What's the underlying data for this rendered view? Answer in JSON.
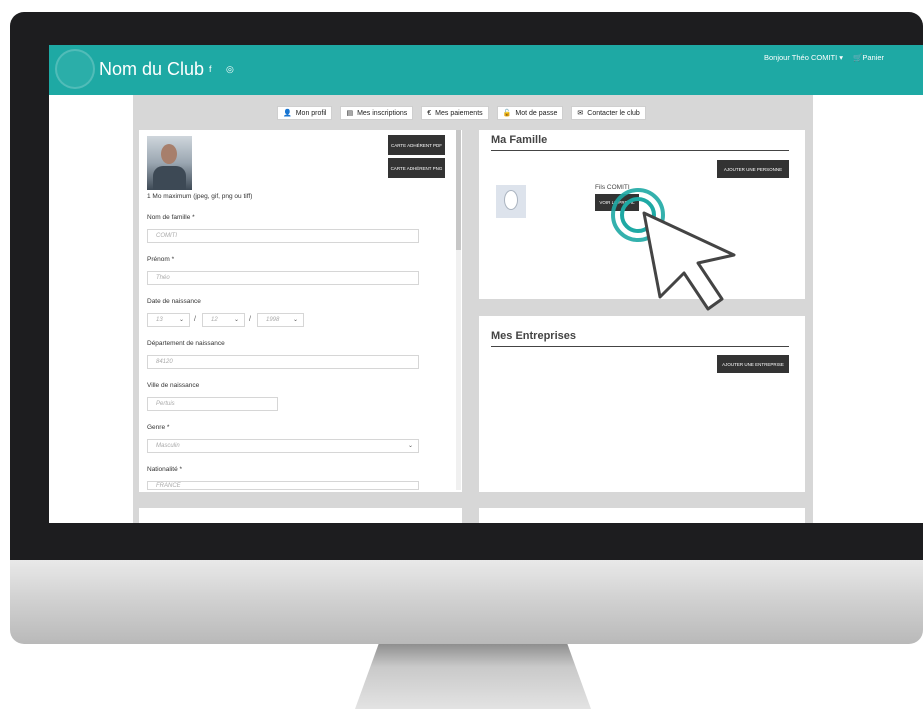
{
  "header": {
    "club_name": "Nom du Club",
    "social": "f ◎",
    "greeting": "Bonjour Théo COMITI ▾",
    "cart_label": "Panier"
  },
  "nav": {
    "tabs": [
      {
        "icon": "user-icon",
        "glyph": "👤",
        "label": "Mon profil"
      },
      {
        "icon": "list-icon",
        "glyph": "▤",
        "label": "Mes inscriptions"
      },
      {
        "icon": "euro-icon",
        "glyph": "€",
        "label": "Mes paiements"
      },
      {
        "icon": "lock-icon",
        "glyph": "🔓",
        "label": "Mot de passe"
      },
      {
        "icon": "envelope-icon",
        "glyph": "✉",
        "label": "Contacter le club"
      }
    ]
  },
  "profile": {
    "card_pdf": "CARTE ADHÉRENT PDF",
    "card_png": "CARTE ADHÉRENT PNG",
    "photo_hint": "1 Mo maximum (jpeg, gif, png ou tiff)",
    "nom_label": "Nom de famille *",
    "nom_value": "COMITI",
    "prenom_label": "Prénom *",
    "prenom_value": "Théo",
    "birth_label": "Date de naissance",
    "birth_day": "13",
    "birth_month": "12",
    "birth_year": "1998",
    "dept_label": "Département de naissance",
    "dept_value": "84120",
    "ville_label": "Ville de naissance",
    "ville_value": "Pertuis",
    "genre_label": "Genre *",
    "genre_value": "Masculin",
    "nat_label": "Nationalité *",
    "nat_value": "FRANCE"
  },
  "famille": {
    "title": "Ma Famille",
    "add_button": "AJOUTER UNE PERSONNE",
    "member_name": "Fils COMITI",
    "view_button": "VOIR LE PROFIL"
  },
  "entreprises": {
    "title": "Mes Entreprises",
    "add_button": "AJOUTER UNE ENTREPRISE"
  },
  "colors": {
    "brand": "#1ea9a4",
    "dark_button": "#333333",
    "content_bg": "#d7d7d7"
  }
}
